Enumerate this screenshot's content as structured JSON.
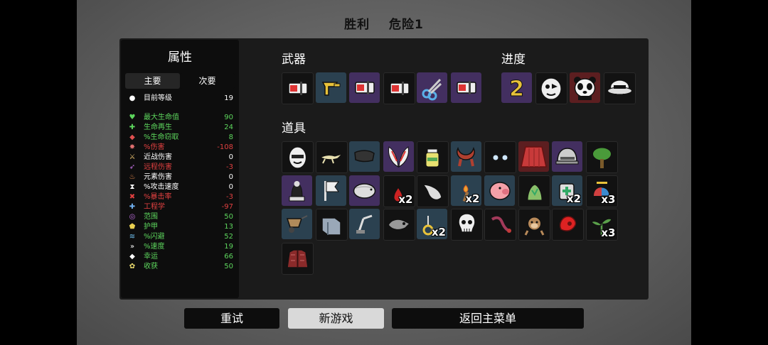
{
  "header": {
    "result": "胜利",
    "danger": "危险1"
  },
  "stats_panel": {
    "title": "属性",
    "tabs": [
      "主要",
      "次要"
    ],
    "stats": [
      {
        "icon": "level-icon",
        "label": "目前等级",
        "value": "19",
        "color": "#ffffff",
        "icon_color": "#ffffff"
      },
      {
        "icon": "heart-icon",
        "label": "最大生命值",
        "value": "90",
        "color": "#5dd65d",
        "icon_color": "#5dd65d"
      },
      {
        "icon": "regen-icon",
        "label": "生命再生",
        "value": "24",
        "color": "#5dd65d",
        "icon_color": "#5dd65d"
      },
      {
        "icon": "lifesteal-icon",
        "label": "%生命窃取",
        "value": "8",
        "color": "#5dd65d",
        "icon_color": "#e05050"
      },
      {
        "icon": "damage-icon",
        "label": "%伤害",
        "value": "-108",
        "color": "#e04040",
        "icon_color": "#e07070"
      },
      {
        "icon": "melee-icon",
        "label": "近战伤害",
        "value": "0",
        "color": "#ffffff",
        "icon_color": "#e8c070"
      },
      {
        "icon": "ranged-icon",
        "label": "远程伤害",
        "value": "-3",
        "color": "#e04040",
        "icon_color": "#c070e0"
      },
      {
        "icon": "elemental-icon",
        "label": "元素伤害",
        "value": "0",
        "color": "#ffffff",
        "icon_color": "#f09050"
      },
      {
        "icon": "attack-speed-icon",
        "label": "%攻击速度",
        "value": "0",
        "color": "#ffffff",
        "icon_color": "#ffffff"
      },
      {
        "icon": "crit-icon",
        "label": "%暴击率",
        "value": "-3",
        "color": "#e04040",
        "icon_color": "#e04040"
      },
      {
        "icon": "engineering-icon",
        "label": "工程学",
        "value": "-97",
        "color": "#e04040",
        "icon_color": "#70b0f0"
      },
      {
        "icon": "range-icon",
        "label": "范围",
        "value": "50",
        "color": "#5dd65d",
        "icon_color": "#c070e0"
      },
      {
        "icon": "armor-icon",
        "label": "护甲",
        "value": "13",
        "color": "#5dd65d",
        "icon_color": "#e8d050"
      },
      {
        "icon": "dodge-icon",
        "label": "%闪避",
        "value": "52",
        "color": "#5dd65d",
        "icon_color": "#70c0f0"
      },
      {
        "icon": "speed-icon",
        "label": "%速度",
        "value": "19",
        "color": "#5dd65d",
        "icon_color": "#ffffff"
      },
      {
        "icon": "luck-icon",
        "label": "幸运",
        "value": "66",
        "color": "#5dd65d",
        "icon_color": "#ffffff"
      },
      {
        "icon": "harvest-icon",
        "label": "收获",
        "value": "50",
        "color": "#5dd65d",
        "icon_color": "#f0e070"
      }
    ]
  },
  "weapons": {
    "title": "武器",
    "items": [
      {
        "icon": "megaphone-icon",
        "tier": "common"
      },
      {
        "icon": "wrench-icon",
        "tier": "uncommon"
      },
      {
        "icon": "megaphone-icon",
        "tier": "rare"
      },
      {
        "icon": "megaphone-icon",
        "tier": "common"
      },
      {
        "icon": "scissors-icon",
        "tier": "rare"
      },
      {
        "icon": "megaphone-icon",
        "tier": "rare"
      }
    ]
  },
  "progress": {
    "title": "进度",
    "items": [
      {
        "icon": "danger-2-icon",
        "tier": "rare",
        "text": "2"
      },
      {
        "icon": "character-face-icon",
        "tier": "common"
      },
      {
        "icon": "panda-icon",
        "tier": "legendary"
      },
      {
        "icon": "ufo-icon",
        "tier": "common"
      }
    ]
  },
  "items": {
    "title": "道具",
    "rows": [
      [
        {
          "icon": "egg-mask-icon",
          "tier": "common"
        },
        {
          "icon": "lizard-icon",
          "tier": "common"
        },
        {
          "icon": "scarf-icon",
          "tier": "uncommon"
        },
        {
          "icon": "wings-icon",
          "tier": "rare"
        },
        {
          "icon": "potion-icon",
          "tier": "common"
        },
        {
          "icon": "horns-icon",
          "tier": "uncommon"
        },
        {
          "icon": "glowing-eyes-icon",
          "tier": "common"
        },
        {
          "icon": "cape-icon",
          "tier": "legendary"
        },
        {
          "icon": "helmet-icon",
          "tier": "rare"
        },
        {
          "icon": "tree-icon",
          "tier": "common"
        }
      ],
      [
        {
          "icon": "statue-icon",
          "tier": "rare"
        },
        {
          "icon": "flag-icon",
          "tier": "uncommon"
        },
        {
          "icon": "tardigrade-icon",
          "tier": "rare"
        },
        {
          "icon": "blood-drop-icon",
          "tier": "common",
          "qty": "x2"
        },
        {
          "icon": "claw-icon",
          "tier": "common"
        },
        {
          "icon": "torch-icon",
          "tier": "uncommon",
          "qty": "x2"
        },
        {
          "icon": "pig-icon",
          "tier": "uncommon"
        },
        {
          "icon": "plant-icon",
          "tier": "common"
        },
        {
          "icon": "medkit-icon",
          "tier": "uncommon",
          "qty": "x2"
        },
        {
          "icon": "propeller-hat-icon",
          "tier": "common",
          "qty": "x3"
        }
      ],
      [
        {
          "icon": "wheelbarrow-icon",
          "tier": "uncommon"
        },
        {
          "icon": "book-icon",
          "tier": "common"
        },
        {
          "icon": "turret-icon",
          "tier": "uncommon"
        },
        {
          "icon": "ghost-tail-icon",
          "tier": "common"
        },
        {
          "icon": "ring-icon",
          "tier": "uncommon",
          "qty": "x2"
        },
        {
          "icon": "skull-icon",
          "tier": "common"
        },
        {
          "icon": "snake-icon",
          "tier": "common"
        },
        {
          "icon": "monkey-icon",
          "tier": "common"
        },
        {
          "icon": "red-shell-icon",
          "tier": "common"
        },
        {
          "icon": "sprout-icon",
          "tier": "common",
          "qty": "x3"
        }
      ],
      [
        {
          "icon": "jacket-icon",
          "tier": "common"
        }
      ]
    ]
  },
  "tier_colors": {
    "common": "#121212",
    "uncommon": "#2b4150",
    "rare": "#432f60",
    "legendary": "#5c1e20"
  },
  "buttons": {
    "retry": "重试",
    "new_game": "新游戏",
    "main_menu": "返回主菜单"
  }
}
